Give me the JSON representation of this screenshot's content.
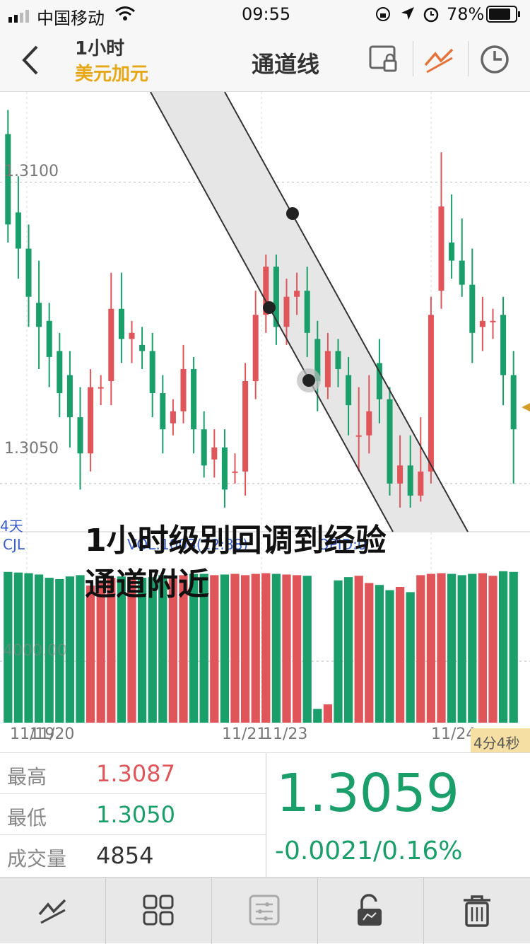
{
  "status": {
    "carrier": "中国移动",
    "time": "09:55",
    "battery": "78%"
  },
  "nav": {
    "period": "1小时",
    "symbol": "美元加元",
    "title": "通道线",
    "icons": [
      "back-arrow-icon",
      "screen-lock-icon",
      "draw-line-icon",
      "clock-icon"
    ]
  },
  "chart": {
    "yticks": [
      "1.3100",
      "1.3050"
    ],
    "corner_label": "4天",
    "indicator": {
      "name": "CJL",
      "vol": "VOL:1003(12:88)",
      "opid": "OPID:0",
      "vol_tick": "4000.00"
    },
    "xticks": [
      "11/19",
      "11/20",
      "11/21",
      "11/23",
      "11/24"
    ],
    "annotation_line1": "1小时级别回调到经验",
    "annotation_line2": "通道附近",
    "timer": "4分4秒"
  },
  "chart_data": {
    "type": "candlestick",
    "ylim": [
      1.3042,
      1.3115
    ],
    "up_color": "#e0555a",
    "down_color": "#1a9e6a",
    "candles": [
      [
        1.3108,
        1.3093,
        1.3112,
        1.309
      ],
      [
        1.3095,
        1.3089,
        1.3101,
        1.3084
      ],
      [
        1.3089,
        1.3081,
        1.3093,
        1.3076
      ],
      [
        1.308,
        1.3076,
        1.3087,
        1.3069
      ],
      [
        1.3077,
        1.3071,
        1.308,
        1.3066
      ],
      [
        1.3072,
        1.3065,
        1.3075,
        1.3061
      ],
      [
        1.3068,
        1.3061,
        1.3072,
        1.3056
      ],
      [
        1.3061,
        1.3055,
        1.3066,
        1.3049
      ],
      [
        1.3055,
        1.3066,
        1.3069,
        1.3052
      ],
      [
        1.3066,
        1.3066,
        1.3068,
        1.3063
      ],
      [
        1.3067,
        1.3079,
        1.3085,
        1.3063
      ],
      [
        1.3079,
        1.3074,
        1.3085,
        1.307
      ],
      [
        1.3074,
        1.3075,
        1.3077,
        1.307
      ],
      [
        1.3073,
        1.3072,
        1.3076,
        1.3069
      ],
      [
        1.3072,
        1.3065,
        1.3075,
        1.3061
      ],
      [
        1.3065,
        1.3059,
        1.3068,
        1.3055
      ],
      [
        1.306,
        1.3062,
        1.3064,
        1.3058
      ],
      [
        1.3062,
        1.3069,
        1.3073,
        1.306
      ],
      [
        1.3069,
        1.3059,
        1.3071,
        1.3055
      ],
      [
        1.3059,
        1.3053,
        1.3062,
        1.3051
      ],
      [
        1.3054,
        1.3056,
        1.3059,
        1.3051
      ],
      [
        1.3056,
        1.3049,
        1.3059,
        1.3046
      ],
      [
        1.3052,
        1.3052,
        1.3055,
        1.305
      ],
      [
        1.3052,
        1.3067,
        1.307,
        1.3048
      ],
      [
        1.3067,
        1.3078,
        1.3082,
        1.3064
      ],
      [
        1.3078,
        1.3086,
        1.3088,
        1.3075
      ],
      [
        1.3086,
        1.3076,
        1.3088,
        1.3073
      ],
      [
        1.3076,
        1.3081,
        1.3084,
        1.3073
      ],
      [
        1.3081,
        1.3082,
        1.3085,
        1.3078
      ],
      [
        1.3082,
        1.3075,
        1.3086,
        1.3071
      ],
      [
        1.3074,
        1.3067,
        1.3077,
        1.3062
      ],
      [
        1.3066,
        1.3072,
        1.3075,
        1.3064
      ],
      [
        1.3072,
        1.3069,
        1.3074,
        1.3066
      ],
      [
        1.3068,
        1.3063,
        1.3071,
        1.3058
      ],
      [
        1.3058,
        1.3058,
        1.3066,
        1.3052
      ],
      [
        1.3058,
        1.3062,
        1.3068,
        1.3055
      ],
      [
        1.307,
        1.3064,
        1.3074,
        1.306
      ],
      [
        1.3064,
        1.305,
        1.3066,
        1.3048
      ],
      [
        1.305,
        1.3053,
        1.3058,
        1.3046
      ],
      [
        1.3053,
        1.3048,
        1.3058,
        1.3046
      ],
      [
        1.3048,
        1.3052,
        1.3061,
        1.3047
      ],
      [
        1.3052,
        1.3078,
        1.3081,
        1.305
      ],
      [
        1.3082,
        1.3096,
        1.3105,
        1.3079
      ],
      [
        1.309,
        1.3087,
        1.3098,
        1.3084
      ],
      [
        1.3087,
        1.3083,
        1.3094,
        1.3081
      ],
      [
        1.3083,
        1.3075,
        1.3089,
        1.307
      ],
      [
        1.3076,
        1.3077,
        1.3081,
        1.3072
      ],
      [
        1.3077,
        1.3077,
        1.3079,
        1.3074
      ],
      [
        1.3078,
        1.3068,
        1.3081,
        1.3063
      ],
      [
        1.3068,
        1.3059,
        1.3072,
        1.305
      ]
    ],
    "volumes": [
      231,
      230,
      229,
      227,
      222,
      220,
      224,
      226,
      210,
      215,
      222,
      224,
      223,
      222,
      223,
      226,
      225,
      226,
      228,
      228,
      226,
      227,
      228,
      226,
      228,
      229,
      228,
      227,
      226,
      225,
      21,
      28,
      218,
      223,
      225,
      214,
      211,
      203,
      208,
      200,
      226,
      228,
      229,
      228,
      226,
      228,
      229,
      225,
      232,
      231
    ],
    "channel": {
      "lower": [
        [
          213,
          0
        ],
        [
          556,
          622
        ]
      ],
      "upper": [
        [
          318,
          0
        ],
        [
          662,
          622
        ]
      ]
    },
    "markers": [
      [
        414,
        172
      ],
      [
        381,
        305
      ],
      [
        437,
        408
      ]
    ]
  },
  "stats": {
    "high_label": "最高",
    "high": "1.3087",
    "low_label": "最低",
    "low": "1.3050",
    "volume_label": "成交量",
    "volume": "4854",
    "price": "1.3059",
    "change": "-0.0021/0.16%"
  },
  "toolbar": [
    "draw-line-icon",
    "grid-icon",
    "settings-sliders-icon",
    "unlock-icon",
    "trash-icon"
  ]
}
